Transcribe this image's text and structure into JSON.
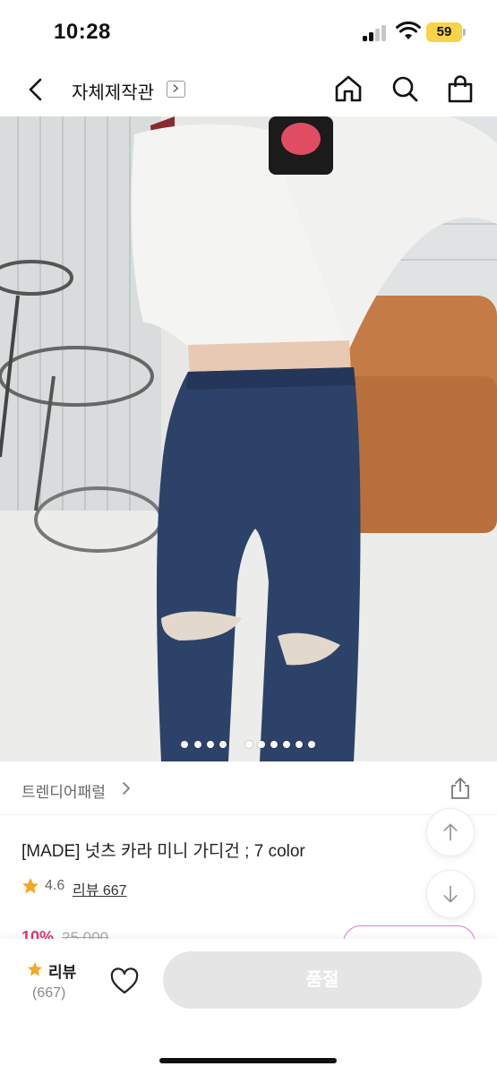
{
  "status_bar": {
    "time": "10:28",
    "battery": "59"
  },
  "nav": {
    "title": "자체제작관"
  },
  "hero": {
    "slide_count": 11,
    "active_index": 0
  },
  "shop": {
    "name": "트렌디어패럴"
  },
  "product": {
    "name": "[MADE] 넛츠 카라 미니 가디건 ; 7 color",
    "rating": "4.6",
    "review_link": "리뷰 667",
    "discount": "10%",
    "original_price": "25,000"
  },
  "bottom_bar": {
    "review_label": "리뷰",
    "review_count": "(667)",
    "soldout_label": "품절"
  },
  "colors": {
    "accent_pink": "#e2356b",
    "star": "#f4a823",
    "coupon_border": "#e27ad9"
  },
  "icons": [
    "back-icon",
    "chevron-right-icon",
    "home-icon",
    "search-icon",
    "bag-icon",
    "share-icon",
    "star-icon",
    "arrow-up-icon",
    "arrow-down-icon",
    "heart-icon"
  ]
}
